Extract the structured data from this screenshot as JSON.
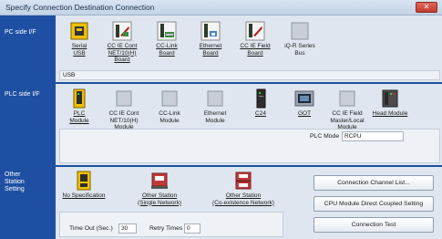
{
  "window": {
    "title": "Specify Connection Destination Connection",
    "close_glyph": "✕"
  },
  "pc_side": {
    "label": "PC side I/F",
    "items": [
      {
        "label": "Serial\nUSB",
        "icon": "serial-usb-icon"
      },
      {
        "label": "CC IE Cont\nNET/10(H)\nBoard",
        "icon": "cc-ie-cont-board-icon"
      },
      {
        "label": "CC-Link\nBoard",
        "icon": "cc-link-board-icon"
      },
      {
        "label": "Ethernet\nBoard",
        "icon": "ethernet-board-icon"
      },
      {
        "label": "CC IE Field\nBoard",
        "icon": "cc-ie-field-board-icon"
      },
      {
        "label": "iQ-R Series\nBus",
        "icon": "iq-r-bus-icon"
      }
    ],
    "selected_label": "USB"
  },
  "plc_side": {
    "label": "PLC side I/F",
    "items": [
      {
        "label": "PLC\nModule",
        "icon": "plc-module-icon"
      },
      {
        "label": "CC IE Cont\nNET/10(H)\nModule",
        "icon": "cc-ie-cont-module-icon"
      },
      {
        "label": "CC-Link\nModule",
        "icon": "cc-link-module-icon"
      },
      {
        "label": "Ethernet\nModule",
        "icon": "ethernet-module-icon"
      },
      {
        "label": "C24",
        "icon": "c24-icon"
      },
      {
        "label": "GOT",
        "icon": "got-icon"
      },
      {
        "label": "CC IE Field\nMaster/Local\nModule",
        "icon": "cc-ie-field-master-icon"
      },
      {
        "label": "Head Module",
        "icon": "head-module-icon"
      }
    ],
    "plc_mode_label": "PLC Mode",
    "plc_mode_value": "RCPU"
  },
  "other_station": {
    "label": "Other\nStation\nSetting",
    "items": [
      {
        "label": "No Specification",
        "icon": "no-specification-icon"
      },
      {
        "label": "Other Station\n(Single Network)",
        "icon": "single-network-icon"
      },
      {
        "label": "Other Station\n(Co-existence Network)",
        "icon": "coexistence-network-icon"
      }
    ],
    "timeout_label": "Time Out (Sec.)",
    "timeout_value": "30",
    "retry_label": "Retry Times",
    "retry_value": "0"
  },
  "buttons": {
    "channel_list": "Connection Channel List...",
    "cpu_direct": "CPU Module Direct Coupled Setting",
    "connection_test": "Connection Test"
  },
  "colors": {
    "side_panel": "#1e4fa2",
    "panel": "#dfe6ef",
    "accent": "#f0c000"
  }
}
